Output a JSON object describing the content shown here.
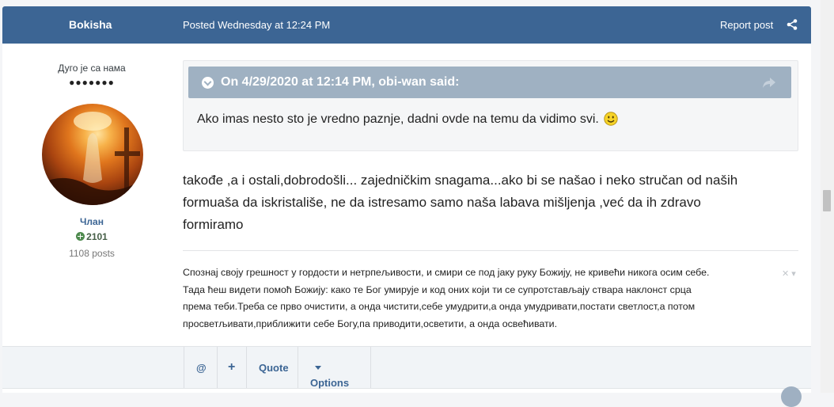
{
  "header": {
    "author": "Bokisha",
    "posted": "Posted Wednesday at 12:24 PM",
    "report": "Report post"
  },
  "author_panel": {
    "rank": "Дуго је са нама",
    "pips": "●●●●●●●",
    "group": "Члан",
    "reputation": "2101",
    "posts": "1108 posts"
  },
  "quote": {
    "citation": "On 4/29/2020 at 12:14 PM, obi-wan said:",
    "text": "Ako imas nesto sto je vredno paznje, dadni ovde na temu da vidimo svi."
  },
  "body": {
    "line1": "takođe ,a i ostali,dobrodošli... zajedničkim snagama...ako bi se našao i neko stručan od naših",
    "line2": "formuaša da iskristališe,  ne da istresamo samo naša labava mišljenja ,već da ih zdravo",
    "line3": "formiramo"
  },
  "signature": {
    "line1": "Спознај своју грешност у гордости и нетрпељивости, и смири се под јаку руку Божију, не кривећи никога осим себе.",
    "line2": "Тада ћеш видети помоћ Божију: како те Бог умирује и код оних који ти се супротстављају ствара наклонст срца",
    "line3": "према теби.Треба се прво очистити, а онда чистити,себе умудрити,а онда умудривати,постати светлост,а потом",
    "line4": "просветљивати,приближити себе Богу,па приводити,осветити, а онда освећивати."
  },
  "controls": {
    "mention": "@",
    "multiquote": "+",
    "quote": "Quote",
    "options": "Options"
  },
  "colors": {
    "header_bg": "#3c6594",
    "citation_bg": "#9fb1c2",
    "accent": "#3c6594"
  }
}
